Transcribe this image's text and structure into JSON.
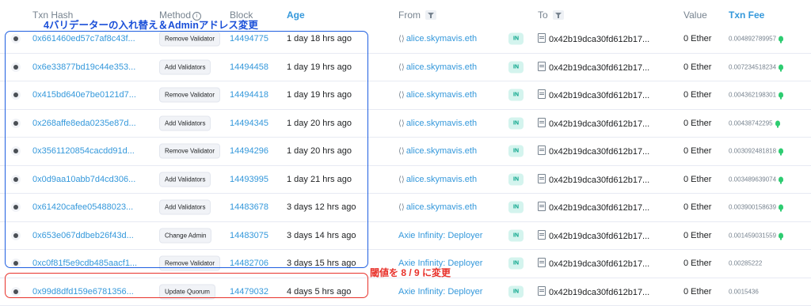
{
  "header": {
    "txn_hash": "Txn Hash",
    "method": "Method",
    "method_info": "i",
    "block": "Block",
    "age": "Age",
    "from": "From",
    "to": "To",
    "value": "Value",
    "txn_fee": "Txn Fee"
  },
  "annotations": {
    "blue": "4バリデーターの入れ替え＆Adminアドレス変更",
    "red": "閾値を 8 / 9 に変更"
  },
  "colors": {
    "link": "#3498db",
    "in_badge_bg": "#d4f4ee",
    "in_badge_text": "#00a186",
    "annotation_blue": "#1a4fd8",
    "annotation_red": "#e8322b"
  },
  "rows": [
    {
      "hash": "0x661460ed57c7af8c43f...",
      "method": "Remove Validator",
      "block": "14494775",
      "age": "1 day 18 hrs ago",
      "from": "alice.skymavis.eth",
      "from_icon": "contract-icon",
      "direction": "IN",
      "to": "0x42b19dca30fd612b17...",
      "value": "0 Ether",
      "fee": "0.004892789957",
      "fee_icon": true
    },
    {
      "hash": "0x6e33877bd19c44e353...",
      "method": "Add Validators",
      "block": "14494458",
      "age": "1 day 19 hrs ago",
      "from": "alice.skymavis.eth",
      "from_icon": "contract-icon",
      "direction": "IN",
      "to": "0x42b19dca30fd612b17...",
      "value": "0 Ether",
      "fee": "0.007234518234",
      "fee_icon": true
    },
    {
      "hash": "0x415bd640e7be0121d7...",
      "method": "Remove Validator",
      "block": "14494418",
      "age": "1 day 19 hrs ago",
      "from": "alice.skymavis.eth",
      "from_icon": "contract-icon",
      "direction": "IN",
      "to": "0x42b19dca30fd612b17...",
      "value": "0 Ether",
      "fee": "0.004362198301",
      "fee_icon": true
    },
    {
      "hash": "0x268affe8eda0235e87d...",
      "method": "Add Validators",
      "block": "14494345",
      "age": "1 day 20 hrs ago",
      "from": "alice.skymavis.eth",
      "from_icon": "contract-icon",
      "direction": "IN",
      "to": "0x42b19dca30fd612b17...",
      "value": "0 Ether",
      "fee": "0.00438742295",
      "fee_icon": true
    },
    {
      "hash": "0x3561120854cacdd91d...",
      "method": "Remove Validator",
      "block": "14494296",
      "age": "1 day 20 hrs ago",
      "from": "alice.skymavis.eth",
      "from_icon": "contract-icon",
      "direction": "IN",
      "to": "0x42b19dca30fd612b17...",
      "value": "0 Ether",
      "fee": "0.003092481818",
      "fee_icon": true
    },
    {
      "hash": "0x0d9aa10abb7d4cd306...",
      "method": "Add Validators",
      "block": "14493995",
      "age": "1 day 21 hrs ago",
      "from": "alice.skymavis.eth",
      "from_icon": "contract-icon",
      "direction": "IN",
      "to": "0x42b19dca30fd612b17...",
      "value": "0 Ether",
      "fee": "0.003489639074",
      "fee_icon": true
    },
    {
      "hash": "0x61420cafee05488023...",
      "method": "Add Validators",
      "block": "14483678",
      "age": "3 days 12 hrs ago",
      "from": "alice.skymavis.eth",
      "from_icon": "contract-icon",
      "direction": "IN",
      "to": "0x42b19dca30fd612b17...",
      "value": "0 Ether",
      "fee": "0.003900158639",
      "fee_icon": true
    },
    {
      "hash": "0x653e067ddbeb26f43d...",
      "method": "Change Admin",
      "block": "14483075",
      "age": "3 days 14 hrs ago",
      "from": "Axie Infinity: Deployer",
      "from_icon": "",
      "direction": "IN",
      "to": "0x42b19dca30fd612b17...",
      "value": "0 Ether",
      "fee": "0.001459031559",
      "fee_icon": true
    },
    {
      "hash": "0xc0f81f5e9cdb485aacf1...",
      "method": "Remove Validator",
      "block": "14482706",
      "age": "3 days 15 hrs ago",
      "from": "Axie Infinity: Deployer",
      "from_icon": "",
      "direction": "IN",
      "to": "0x42b19dca30fd612b17...",
      "value": "0 Ether",
      "fee": "0.00285222",
      "fee_icon": false
    },
    {
      "hash": "0x99d8dfd159e6781356...",
      "method": "Update Quorum",
      "block": "14479032",
      "age": "4 days 5 hrs ago",
      "from": "Axie Infinity: Deployer",
      "from_icon": "",
      "direction": "IN",
      "to": "0x42b19dca30fd612b17...",
      "value": "0 Ether",
      "fee": "0.0015436",
      "fee_icon": false
    }
  ]
}
